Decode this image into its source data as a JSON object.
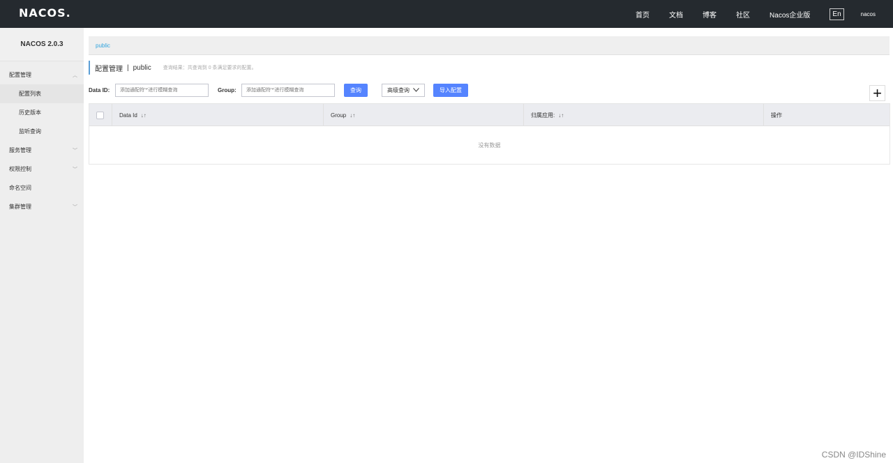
{
  "topbar": {
    "logo": "NACOS.",
    "nav": [
      "首页",
      "文档",
      "博客",
      "社区",
      "Nacos企业版"
    ],
    "lang": "En",
    "user": "nacos"
  },
  "sidebar": {
    "title": "NACOS 2.0.3",
    "groups": [
      {
        "label": "配置管理",
        "expanded": true,
        "items": [
          "配置列表",
          "历史版本",
          "监听查询"
        ]
      },
      {
        "label": "服务管理",
        "expanded": false
      },
      {
        "label": "权限控制",
        "expanded": false
      },
      {
        "label": "命名空间"
      },
      {
        "label": "集群管理",
        "expanded": false
      }
    ]
  },
  "main": {
    "namespace_tab": "public",
    "page_title": "配置管理",
    "page_sep": "|",
    "page_namespace": "public",
    "result_text": "查询结果：共查询到 0 条满足要求的配置。",
    "filters": {
      "data_id_label": "Data ID:",
      "data_id_placeholder": "添加通配符'*'进行模糊查询",
      "group_label": "Group:",
      "group_placeholder": "添加通配符'*'进行模糊查询",
      "query_button": "查询",
      "advanced_button": "高级查询",
      "import_button": "导入配置"
    },
    "table": {
      "columns": [
        "Data Id",
        "Group",
        "归属应用:",
        "操作"
      ],
      "empty_text": "没有数据"
    }
  },
  "watermark": "CSDN @IDShine"
}
